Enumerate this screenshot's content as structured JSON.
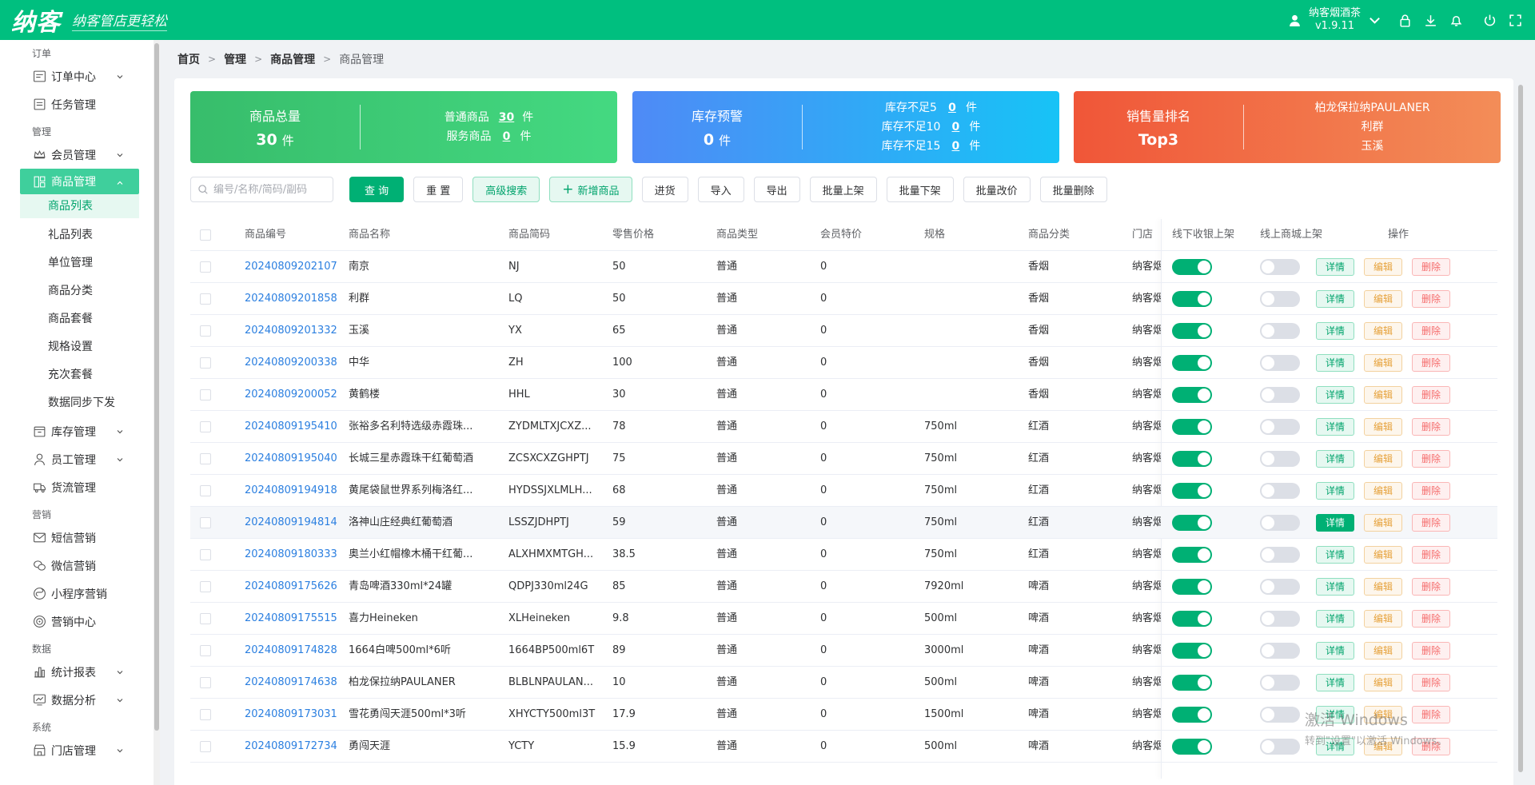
{
  "brand": {
    "logo": "纳客",
    "slogan": "纳客管店更轻松"
  },
  "topbar": {
    "user_name": "纳客烟酒茶",
    "version": "v1.9.11"
  },
  "sidebar": {
    "sections": [
      {
        "title": "订单"
      },
      {
        "title": "管理"
      },
      {
        "title": "营销"
      },
      {
        "title": "数据"
      },
      {
        "title": "系统"
      }
    ],
    "items": {
      "order_center": "订单中心",
      "task_mgmt": "任务管理",
      "member_mgmt": "会员管理",
      "goods_mgmt": "商品管理",
      "goods_list": "商品列表",
      "gift_list": "礼品列表",
      "unit_mgmt": "单位管理",
      "goods_category": "商品分类",
      "goods_package": "商品套餐",
      "spec_settings": "规格设置",
      "recharge_package": "充次套餐",
      "data_sync": "数据同步下发",
      "stock_mgmt": "库存管理",
      "staff_mgmt": "员工管理",
      "logistics_mgmt": "货流管理",
      "sms_marketing": "短信营销",
      "wechat_marketing": "微信营销",
      "miniapp_marketing": "小程序营销",
      "marketing_center": "营销中心",
      "stats_report": "统计报表",
      "data_analysis": "数据分析",
      "store_mgmt": "门店管理"
    }
  },
  "breadcrumb": {
    "home": "首页",
    "manage": "管理",
    "goods": "商品管理",
    "current": "商品管理"
  },
  "cards": {
    "total": {
      "title": "商品总量",
      "value": "30",
      "unit": "件",
      "normal_label": "普通商品",
      "normal_value": "30",
      "normal_unit": "件",
      "service_label": "服务商品",
      "service_value": "0",
      "service_unit": "件"
    },
    "stock": {
      "title": "库存预警",
      "value": "0",
      "unit": "件",
      "l5_label": "库存不足5",
      "l5_value": "0",
      "l10_label": "库存不足10",
      "l10_value": "0",
      "l15_label": "库存不足15",
      "l15_value": "0",
      "unit2": "件"
    },
    "sales": {
      "title": "销售量排名",
      "value": "Top3",
      "r1": "柏龙保拉纳PAULANER",
      "r2": "利群",
      "r3": "玉溪"
    }
  },
  "toolbar": {
    "search_placeholder": "编号/名称/简码/副码",
    "query": "查 询",
    "reset": "重 置",
    "advanced": "高级搜索",
    "add": "新增商品",
    "purchase": "进货",
    "import": "导入",
    "export": "导出",
    "batch_on": "批量上架",
    "batch_off": "批量下架",
    "batch_price": "批量改价",
    "batch_delete": "批量删除"
  },
  "table": {
    "headers": {
      "code": "商品编号",
      "name": "商品名称",
      "abbr": "商品简码",
      "price": "零售价格",
      "type": "商品类型",
      "member_price": "会员特价",
      "spec": "规格",
      "category": "商品分类",
      "store": "门店",
      "offline": "线下收银上架",
      "online": "线上商城上架",
      "ops": "操作"
    },
    "actions": {
      "detail": "详情",
      "edit": "编辑",
      "delete": "删除"
    },
    "rows": [
      {
        "code": "20240809202107",
        "name": "南京",
        "abbr": "NJ",
        "price": "50",
        "type": "普通",
        "member_price": "0",
        "spec": "",
        "category": "香烟",
        "store": "纳客烟",
        "offline": true,
        "online": false
      },
      {
        "code": "20240809201858",
        "name": "利群",
        "abbr": "LQ",
        "price": "50",
        "type": "普通",
        "member_price": "0",
        "spec": "",
        "category": "香烟",
        "store": "纳客烟",
        "offline": true,
        "online": false
      },
      {
        "code": "20240809201332",
        "name": "玉溪",
        "abbr": "YX",
        "price": "65",
        "type": "普通",
        "member_price": "0",
        "spec": "",
        "category": "香烟",
        "store": "纳客烟",
        "offline": true,
        "online": false
      },
      {
        "code": "20240809200338",
        "name": "中华",
        "abbr": "ZH",
        "price": "100",
        "type": "普通",
        "member_price": "0",
        "spec": "",
        "category": "香烟",
        "store": "纳客烟",
        "offline": true,
        "online": false
      },
      {
        "code": "20240809200052",
        "name": "黄鹤楼",
        "abbr": "HHL",
        "price": "30",
        "type": "普通",
        "member_price": "0",
        "spec": "",
        "category": "香烟",
        "store": "纳客烟",
        "offline": true,
        "online": false
      },
      {
        "code": "20240809195410",
        "name": "张裕多名利特选级赤霞珠...",
        "abbr": "ZYDMLTXJCXZ...",
        "price": "78",
        "type": "普通",
        "member_price": "0",
        "spec": "750ml",
        "category": "红酒",
        "store": "纳客烟",
        "offline": true,
        "online": false
      },
      {
        "code": "20240809195040",
        "name": "长城三星赤霞珠干红葡萄酒",
        "abbr": "ZCSXCXZGHPTJ",
        "price": "75",
        "type": "普通",
        "member_price": "0",
        "spec": "750ml",
        "category": "红酒",
        "store": "纳客烟",
        "offline": true,
        "online": false
      },
      {
        "code": "20240809194918",
        "name": "黄尾袋鼠世界系列梅洛红...",
        "abbr": "HYDSSJXLMLH...",
        "price": "68",
        "type": "普通",
        "member_price": "0",
        "spec": "750ml",
        "category": "红酒",
        "store": "纳客烟",
        "offline": true,
        "online": false
      },
      {
        "code": "20240809194814",
        "name": "洛神山庄经典红葡萄酒",
        "abbr": "LSSZJDHPTJ",
        "price": "59",
        "type": "普通",
        "member_price": "0",
        "spec": "750ml",
        "category": "红酒",
        "store": "纳客烟",
        "offline": true,
        "online": false
      },
      {
        "code": "20240809180333",
        "name": "奥兰小红帽橡木桶干红葡...",
        "abbr": "ALXHMXMTGH...",
        "price": "38.5",
        "type": "普通",
        "member_price": "0",
        "spec": "750ml",
        "category": "红酒",
        "store": "纳客烟",
        "offline": true,
        "online": false
      },
      {
        "code": "20240809175626",
        "name": "青岛啤酒330ml*24罐",
        "abbr": "QDPJ330ml24G",
        "price": "85",
        "type": "普通",
        "member_price": "0",
        "spec": "7920ml",
        "category": "啤酒",
        "store": "纳客烟",
        "offline": true,
        "online": false
      },
      {
        "code": "20240809175515",
        "name": "喜力Heineken",
        "abbr": "XLHeineken",
        "price": "9.8",
        "type": "普通",
        "member_price": "0",
        "spec": "500ml",
        "category": "啤酒",
        "store": "纳客烟",
        "offline": true,
        "online": false
      },
      {
        "code": "20240809174828",
        "name": "1664白啤500ml*6听",
        "abbr": "1664BP500ml6T",
        "price": "89",
        "type": "普通",
        "member_price": "0",
        "spec": "3000ml",
        "category": "啤酒",
        "store": "纳客烟",
        "offline": true,
        "online": false
      },
      {
        "code": "20240809174638",
        "name": "柏龙保拉纳PAULANER",
        "abbr": "BLBLNPAULAN...",
        "price": "10",
        "type": "普通",
        "member_price": "0",
        "spec": "500ml",
        "category": "啤酒",
        "store": "纳客烟",
        "offline": true,
        "online": false
      },
      {
        "code": "20240809173031",
        "name": "雪花勇闯天涯500ml*3听",
        "abbr": "XHYCTY500ml3T",
        "price": "17.9",
        "type": "普通",
        "member_price": "0",
        "spec": "1500ml",
        "category": "啤酒",
        "store": "纳客烟",
        "offline": true,
        "online": false
      },
      {
        "code": "20240809172734",
        "name": "勇闯天涯",
        "abbr": "YCTY",
        "price": "15.9",
        "type": "普通",
        "member_price": "0",
        "spec": "500ml",
        "category": "啤酒",
        "store": "纳客烟",
        "offline": true,
        "online": false
      }
    ]
  },
  "watermark": {
    "line1": "激活 Windows",
    "line2": "转到\"设置\"以激活 Windows。"
  },
  "colors": {
    "brand": "#00bf7f",
    "primary": "#00b074",
    "link": "#2b7fe0",
    "warning": "#e6a23c",
    "danger": "#f56c6c"
  }
}
